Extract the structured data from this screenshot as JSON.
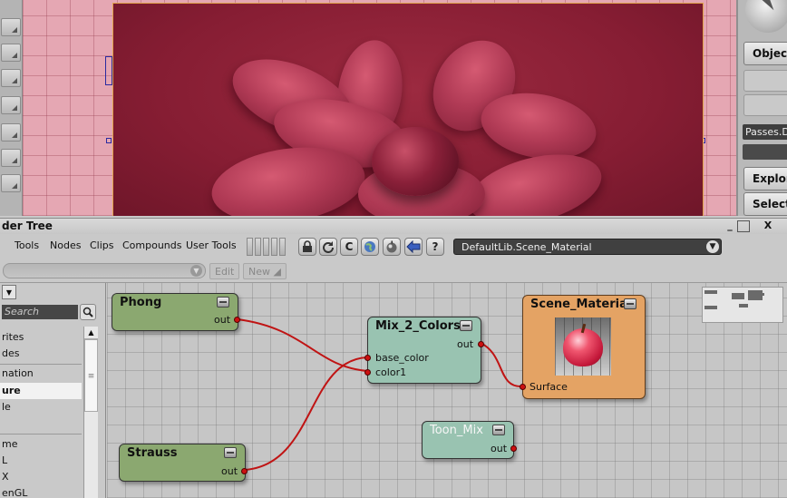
{
  "viewport": {
    "panel_buttons": {
      "object_label": "Object",
      "passes_label": "Passes.De",
      "explorer_label": "Explore",
      "selection_label": "Selection"
    }
  },
  "render_tree": {
    "title": "der Tree",
    "window_controls": [
      "_",
      "□",
      "X"
    ],
    "menu": [
      "Tools",
      "Nodes",
      "Clips",
      "Compounds",
      "User Tools"
    ],
    "toolbar_icons": [
      "lock-icon",
      "refresh-icon",
      "c-icon",
      "globe-icon",
      "render-preview-icon",
      "back-arrow-icon",
      "help-icon"
    ],
    "help_glyph": "?",
    "c_glyph": "C",
    "material_select": "DefaultLib.Scene_Material",
    "edit_label": "Edit",
    "new_label": "New"
  },
  "explorer": {
    "search_placeholder": "Search",
    "items": [
      "rites",
      "des",
      "nation",
      "ure",
      "le",
      "me",
      "L",
      "X",
      "enGL"
    ],
    "selected_index": 3
  },
  "nodes": {
    "phong": {
      "title": "Phong",
      "out": "out"
    },
    "strauss": {
      "title": "Strauss",
      "out": "out"
    },
    "mix": {
      "title": "Mix_2_Colors",
      "out": "out",
      "in1": "base_color",
      "in2": "color1"
    },
    "scene": {
      "title": "Scene_Material",
      "in": "Surface"
    },
    "toon": {
      "title": "Toon_Mix",
      "out": "out"
    }
  },
  "colors": {
    "wire": "#c01414",
    "node_green": "#8ba870",
    "node_teal": "#99c3b1",
    "node_orange": "#e4a364"
  }
}
